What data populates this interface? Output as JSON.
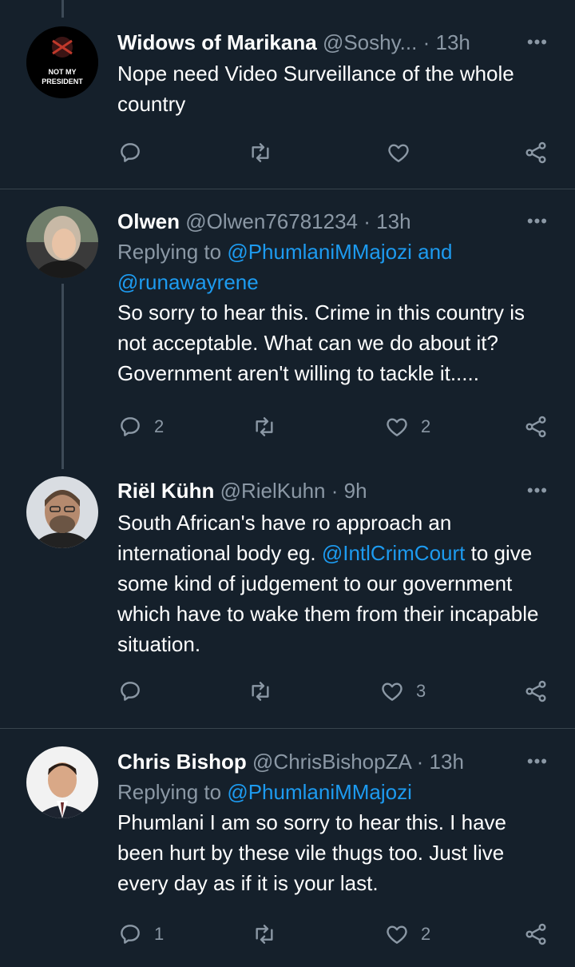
{
  "tweets": [
    {
      "name": "Widows of Marikana",
      "handle": "@Soshy...",
      "time": "13h",
      "avatar_text_line1": "NOT MY",
      "avatar_text_line2": "PRESIDENT",
      "reply_prefix": "",
      "reply_mentions": [],
      "body": "Nope need Video Surveillance of the whole country",
      "reply_count": "",
      "retweet_count": "",
      "like_count": ""
    },
    {
      "name": "Olwen",
      "handle": "@Olwen76781234",
      "time": "13h",
      "reply_prefix": "Replying to",
      "reply_mention_1": "@PhumlaniMMajozi and",
      "reply_mention_2": "@runawayrene",
      "body": "So sorry to hear this. Crime in this country is not acceptable. What can we do about it? Government aren't willing to tackle it.....",
      "reply_count": "2",
      "retweet_count": "",
      "like_count": "2"
    },
    {
      "name": "Riël Kühn",
      "handle": "@RielKuhn",
      "time": "9h",
      "body_part1": "South African's have ro approach an international body eg.",
      "body_mention": "@IntlCrimCourt",
      "body_part2": "to give some kind of judgement to our government which have to wake them from their incapable situation.",
      "reply_count": "",
      "retweet_count": "",
      "like_count": "3"
    },
    {
      "name": "Chris Bishop",
      "handle": "@ChrisBishopZA",
      "time": "13h",
      "reply_prefix": "Replying to",
      "reply_mention_1": "@PhumlaniMMajozi",
      "body": "Phumlani I am so sorry to hear this. I have been hurt by these vile thugs too.  Just live every day as if it is your last.",
      "reply_count": "1",
      "retweet_count": "",
      "like_count": "2"
    }
  ],
  "separator": "·",
  "more_label": "•••",
  "colors": {
    "background": "#15202b",
    "muted": "#8b98a5",
    "accent": "#1d9bf0",
    "divider": "#38444d"
  },
  "icons": [
    "reply-icon",
    "retweet-icon",
    "like-icon",
    "share-icon",
    "more-icon"
  ]
}
